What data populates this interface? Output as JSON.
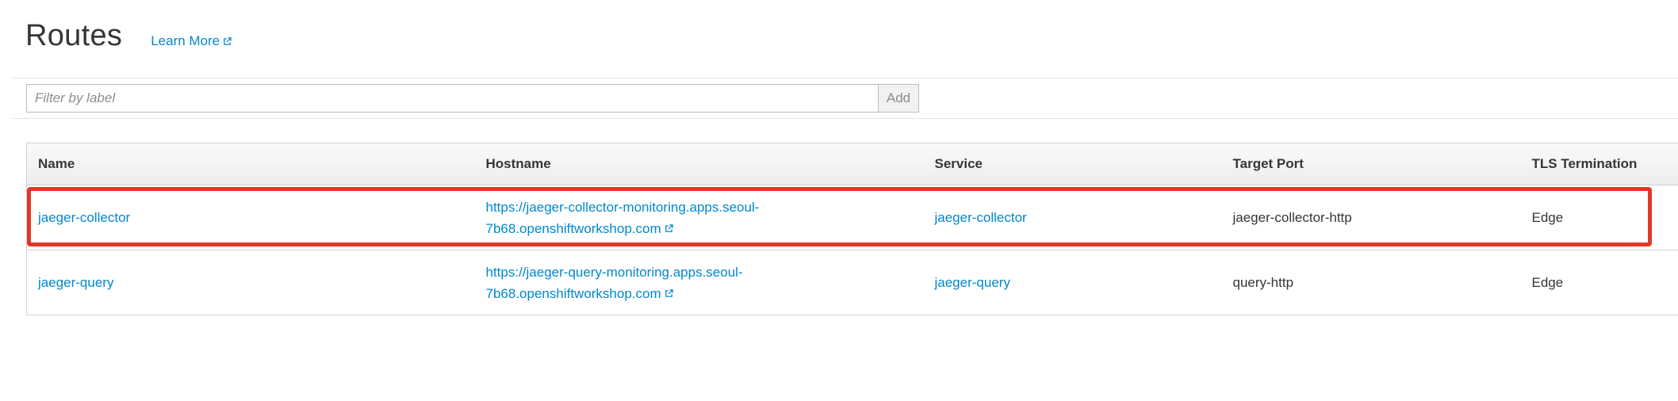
{
  "header": {
    "title": "Routes",
    "learn_more": "Learn More"
  },
  "filter": {
    "placeholder": "Filter by label",
    "value": "",
    "add_label": "Add"
  },
  "table": {
    "columns": [
      "Name",
      "Hostname",
      "Service",
      "Target Port",
      "TLS Termination"
    ],
    "rows": [
      {
        "name": "jaeger-collector",
        "hostname_line1": "https://jaeger-collector-monitoring.apps.seoul-",
        "hostname_line2": "7b68.openshiftworkshop.com",
        "service": "jaeger-collector",
        "target_port": "jaeger-collector-http",
        "tls": "Edge"
      },
      {
        "name": "jaeger-query",
        "hostname_line1": "https://jaeger-query-monitoring.apps.seoul-",
        "hostname_line2": "7b68.openshiftworkshop.com",
        "service": "jaeger-query",
        "target_port": "query-http",
        "tls": "Edge"
      }
    ]
  },
  "colors": {
    "link": "#0088ce",
    "highlight": "#e53527"
  },
  "icons": {
    "external_link": "external-link-icon"
  }
}
